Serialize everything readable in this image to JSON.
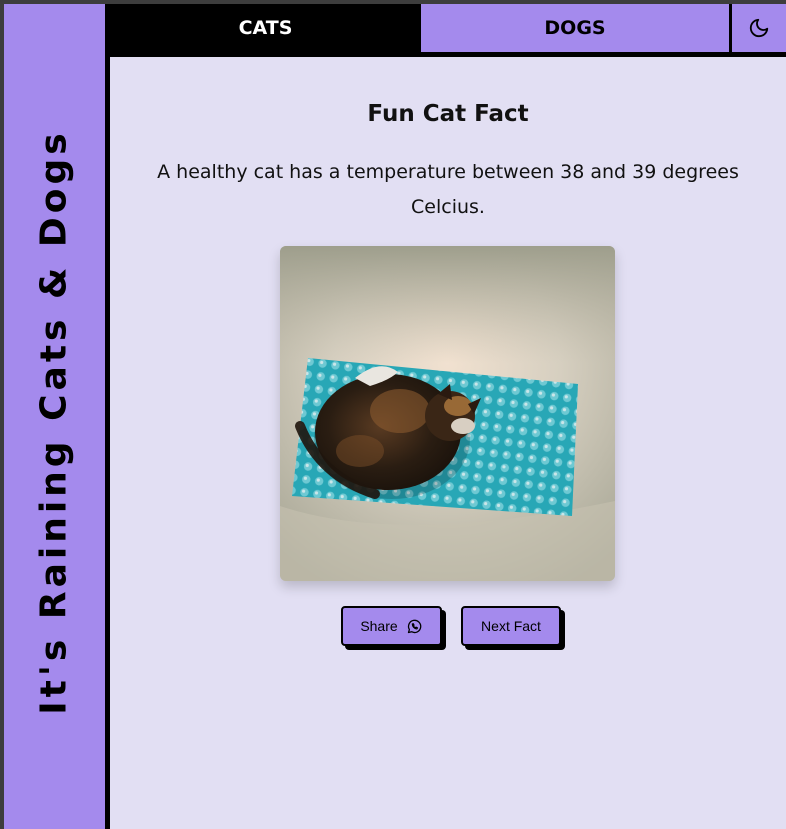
{
  "sidebar": {
    "title": "It's Raining Cats & Dogs"
  },
  "tabs": [
    {
      "label": "CATS",
      "active": true
    },
    {
      "label": "DOGS",
      "active": false
    }
  ],
  "header": {
    "theme_toggle_icon": "moon-icon"
  },
  "fact": {
    "heading": "Fun Cat Fact",
    "text": "A healthy cat has a temperature between 38 and 39 degrees Celcius."
  },
  "buttons": {
    "share_label": "Share",
    "share_icon": "whatsapp-icon",
    "next_label": "Next Fact"
  },
  "colors": {
    "accent": "#a48aed",
    "background": "#e2dff3",
    "border": "#000000"
  }
}
